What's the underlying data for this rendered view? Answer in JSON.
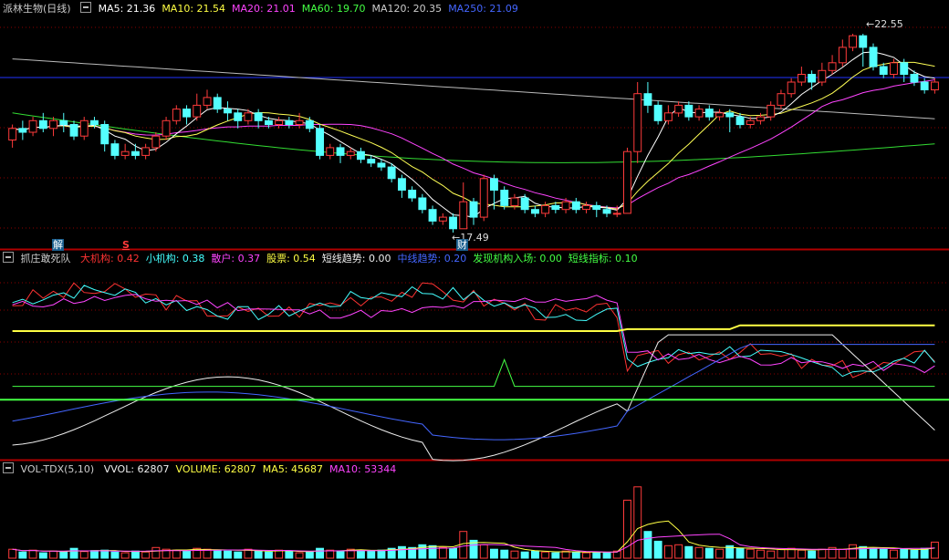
{
  "main": {
    "title": "派林生物(日线)",
    "ma": [
      {
        "label": "MA5: 21.36",
        "color": "#ffffff"
      },
      {
        "label": "MA10: 21.54",
        "color": "#ffff44"
      },
      {
        "label": "MA20: 21.01",
        "color": "#ff44ff"
      },
      {
        "label": "MA60: 19.70",
        "color": "#44ff44"
      },
      {
        "label": "MA120: 20.35",
        "color": "#cccccc"
      },
      {
        "label": "MA250: 21.09",
        "color": "#4466ff"
      }
    ],
    "high_label": "22.55",
    "low_label": "17.49",
    "marker_cai": "财",
    "marker_jie": "解",
    "marker_s": "S"
  },
  "indicator": {
    "title": "抓庄敢死队",
    "items": [
      {
        "label": "大机构: 0.42",
        "color": "#ff3333"
      },
      {
        "label": "小机构: 0.38",
        "color": "#44ffff"
      },
      {
        "label": "散户: 0.37",
        "color": "#ff44ff"
      },
      {
        "label": "股票: 0.54",
        "color": "#ffff44"
      },
      {
        "label": "短线趋势: 0.00",
        "color": "#eeeeee"
      },
      {
        "label": "中线趋势: 0.20",
        "color": "#4466ff"
      },
      {
        "label": "发现机构入场: 0.00",
        "color": "#44ff44"
      },
      {
        "label": "短线指标: 0.10",
        "color": "#44ff44"
      }
    ]
  },
  "volume": {
    "title": "VOL-TDX(5,10)",
    "items": [
      {
        "label": "VVOL: 62807",
        "color": "#eeeeee"
      },
      {
        "label": "VOLUME: 62807",
        "color": "#ffff44"
      },
      {
        "label": "MA5: 45687",
        "color": "#ffff44"
      },
      {
        "label": "MA10: 53344",
        "color": "#ff44ff"
      }
    ]
  },
  "colors": {
    "up": "#ff3b3b",
    "down": "#54ffff",
    "grid": "#8b0000",
    "background": "#000000"
  },
  "chart_data": {
    "type": "candlestick",
    "price_range": [
      17.0,
      23.0
    ],
    "ma": {
      "ma60_end": 19.7,
      "ma120_end": 20.35,
      "ma250_end": 21.09,
      "ma20_end": 21.01
    },
    "candles": [
      [
        19.8,
        20.1,
        19.6,
        20.2
      ],
      [
        20.1,
        20.0,
        19.8,
        20.3
      ],
      [
        20.0,
        20.3,
        19.9,
        20.4
      ],
      [
        20.3,
        20.1,
        20.0,
        20.5
      ],
      [
        20.1,
        20.3,
        19.9,
        20.4
      ],
      [
        20.3,
        20.2,
        20.0,
        20.5
      ],
      [
        20.2,
        19.9,
        19.8,
        20.3
      ],
      [
        19.9,
        20.3,
        19.8,
        20.4
      ],
      [
        20.3,
        20.2,
        20.1,
        20.4
      ],
      [
        20.2,
        19.7,
        19.5,
        20.3
      ],
      [
        19.7,
        19.4,
        19.3,
        19.8
      ],
      [
        19.4,
        19.5,
        19.3,
        19.7
      ],
      [
        19.5,
        19.4,
        19.3,
        19.7
      ],
      [
        19.4,
        19.6,
        19.3,
        19.7
      ],
      [
        19.6,
        19.9,
        19.5,
        20.0
      ],
      [
        19.9,
        20.3,
        19.8,
        20.4
      ],
      [
        20.3,
        20.6,
        20.2,
        20.7
      ],
      [
        20.6,
        20.4,
        20.2,
        20.7
      ],
      [
        20.4,
        20.7,
        20.3,
        21.0
      ],
      [
        20.7,
        20.9,
        20.6,
        21.1
      ],
      [
        20.9,
        20.6,
        20.5,
        21.0
      ],
      [
        20.6,
        20.5,
        20.3,
        20.8
      ],
      [
        20.5,
        20.3,
        20.1,
        20.6
      ],
      [
        20.3,
        20.5,
        20.2,
        20.6
      ],
      [
        20.5,
        20.3,
        20.1,
        20.6
      ],
      [
        20.3,
        20.2,
        20.1,
        20.4
      ],
      [
        20.2,
        20.3,
        20.1,
        20.4
      ],
      [
        20.3,
        20.2,
        20.1,
        20.4
      ],
      [
        20.2,
        20.3,
        20.1,
        20.5
      ],
      [
        20.3,
        20.1,
        20.0,
        20.4
      ],
      [
        20.1,
        19.4,
        19.3,
        20.2
      ],
      [
        19.4,
        19.6,
        19.3,
        19.7
      ],
      [
        19.6,
        19.4,
        19.2,
        19.7
      ],
      [
        19.4,
        19.5,
        19.3,
        19.6
      ],
      [
        19.5,
        19.3,
        19.2,
        19.6
      ],
      [
        19.3,
        19.2,
        19.1,
        19.4
      ],
      [
        19.2,
        19.1,
        19.0,
        19.3
      ],
      [
        19.1,
        18.8,
        18.7,
        19.2
      ],
      [
        18.8,
        18.5,
        18.3,
        18.9
      ],
      [
        18.5,
        18.3,
        18.2,
        18.6
      ],
      [
        18.3,
        18.0,
        17.9,
        18.4
      ],
      [
        18.0,
        17.7,
        17.6,
        18.1
      ],
      [
        17.7,
        17.8,
        17.6,
        17.9
      ],
      [
        17.8,
        17.5,
        17.4,
        17.9
      ],
      [
        17.5,
        18.2,
        17.5,
        18.7
      ],
      [
        18.2,
        17.8,
        17.6,
        18.3
      ],
      [
        17.8,
        18.8,
        17.7,
        18.9
      ],
      [
        18.8,
        18.5,
        18.0,
        18.9
      ],
      [
        18.5,
        18.1,
        18.0,
        18.6
      ],
      [
        18.1,
        18.3,
        18.0,
        18.4
      ],
      [
        18.3,
        18.0,
        17.9,
        18.4
      ],
      [
        18.0,
        17.9,
        17.8,
        18.1
      ],
      [
        17.9,
        18.1,
        17.8,
        18.2
      ],
      [
        18.1,
        18.0,
        17.9,
        18.2
      ],
      [
        18.0,
        18.2,
        17.9,
        18.3
      ],
      [
        18.2,
        18.0,
        17.9,
        18.3
      ],
      [
        18.0,
        18.1,
        17.9,
        18.2
      ],
      [
        18.1,
        18.0,
        17.8,
        18.2
      ],
      [
        18.0,
        17.9,
        17.8,
        18.1
      ],
      [
        17.9,
        17.9,
        17.8,
        18.1
      ],
      [
        17.9,
        19.5,
        17.9,
        19.6
      ],
      [
        19.5,
        21.0,
        19.2,
        21.3
      ],
      [
        21.0,
        20.7,
        20.5,
        21.3
      ],
      [
        20.7,
        20.3,
        20.2,
        20.8
      ],
      [
        20.3,
        20.5,
        20.2,
        20.7
      ],
      [
        20.5,
        20.7,
        20.4,
        20.8
      ],
      [
        20.7,
        20.4,
        20.3,
        20.8
      ],
      [
        20.4,
        20.6,
        20.3,
        20.7
      ],
      [
        20.6,
        20.4,
        20.3,
        20.7
      ],
      [
        20.4,
        20.5,
        20.3,
        20.6
      ],
      [
        20.5,
        20.4,
        20.0,
        20.6
      ],
      [
        20.4,
        20.2,
        20.1,
        20.5
      ],
      [
        20.2,
        20.3,
        20.1,
        20.4
      ],
      [
        20.3,
        20.4,
        20.2,
        20.5
      ],
      [
        20.4,
        20.7,
        20.3,
        20.8
      ],
      [
        20.7,
        21.0,
        20.6,
        21.1
      ],
      [
        21.0,
        21.3,
        20.9,
        21.4
      ],
      [
        21.3,
        21.5,
        21.2,
        21.7
      ],
      [
        21.5,
        21.3,
        21.1,
        21.6
      ],
      [
        21.3,
        21.6,
        21.2,
        21.8
      ],
      [
        21.6,
        21.8,
        21.5,
        22.0
      ],
      [
        21.8,
        22.2,
        21.7,
        22.4
      ],
      [
        22.2,
        22.5,
        22.1,
        22.55
      ],
      [
        22.5,
        22.2,
        21.7,
        22.55
      ],
      [
        22.2,
        21.7,
        21.6,
        22.3
      ],
      [
        21.7,
        21.5,
        21.4,
        21.8
      ],
      [
        21.5,
        21.8,
        21.4,
        21.9
      ],
      [
        21.8,
        21.5,
        21.3,
        21.9
      ],
      [
        21.5,
        21.3,
        21.2,
        21.6
      ],
      [
        21.3,
        21.1,
        21.0,
        21.4
      ],
      [
        21.1,
        21.3,
        21.0,
        21.4
      ]
    ],
    "volume": [
      20,
      14,
      18,
      12,
      16,
      14,
      22,
      15,
      17,
      18,
      14,
      12,
      16,
      14,
      24,
      20,
      18,
      16,
      22,
      20,
      18,
      16,
      14,
      20,
      16,
      14,
      18,
      16,
      12,
      14,
      22,
      18,
      16,
      20,
      18,
      16,
      18,
      22,
      26,
      24,
      30,
      28,
      24,
      22,
      60,
      40,
      30,
      20,
      18,
      16,
      14,
      16,
      14,
      12,
      16,
      14,
      12,
      14,
      12,
      16,
      130,
      160,
      60,
      38,
      28,
      30,
      26,
      24,
      22,
      20,
      28,
      22,
      20,
      18,
      16,
      20,
      22,
      18,
      16,
      20,
      24,
      20,
      30,
      26,
      22,
      20,
      18,
      20,
      18,
      22,
      36
    ],
    "volume_range": [
      0,
      180
    ]
  }
}
